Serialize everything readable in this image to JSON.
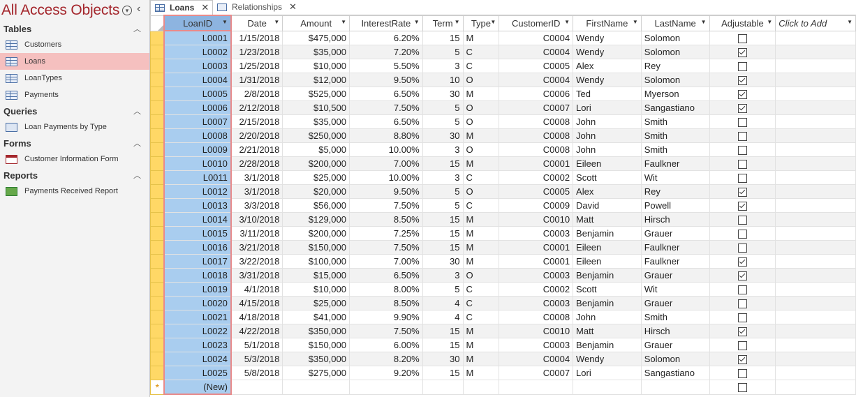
{
  "nav": {
    "title": "All Access Objects",
    "groups": [
      {
        "label": "Tables",
        "items": [
          "Customers",
          "Loans",
          "LoanTypes",
          "Payments"
        ]
      },
      {
        "label": "Queries",
        "items": [
          "Loan Payments by Type"
        ]
      },
      {
        "label": "Forms",
        "items": [
          "Customer Information Form"
        ]
      },
      {
        "label": "Reports",
        "items": [
          "Payments Received Report"
        ]
      }
    ],
    "selected_item": "Loans"
  },
  "tabs": [
    {
      "label": "Loans",
      "active": true
    },
    {
      "label": "Relationships",
      "active": false
    }
  ],
  "columns": [
    "LoanID",
    "Date",
    "Amount",
    "InterestRate",
    "Term",
    "Type",
    "CustomerID",
    "FirstName",
    "LastName",
    "Adjustable",
    "Click to Add"
  ],
  "rows": [
    [
      "L0001",
      "1/15/2018",
      "$475,000",
      "6.20%",
      "15",
      "M",
      "C0004",
      "Wendy",
      "Solomon",
      false
    ],
    [
      "L0002",
      "1/23/2018",
      "$35,000",
      "7.20%",
      "5",
      "C",
      "C0004",
      "Wendy",
      "Solomon",
      true
    ],
    [
      "L0003",
      "1/25/2018",
      "$10,000",
      "5.50%",
      "3",
      "C",
      "C0005",
      "Alex",
      "Rey",
      false
    ],
    [
      "L0004",
      "1/31/2018",
      "$12,000",
      "9.50%",
      "10",
      "O",
      "C0004",
      "Wendy",
      "Solomon",
      true
    ],
    [
      "L0005",
      "2/8/2018",
      "$525,000",
      "6.50%",
      "30",
      "M",
      "C0006",
      "Ted",
      "Myerson",
      true
    ],
    [
      "L0006",
      "2/12/2018",
      "$10,500",
      "7.50%",
      "5",
      "O",
      "C0007",
      "Lori",
      "Sangastiano",
      true
    ],
    [
      "L0007",
      "2/15/2018",
      "$35,000",
      "6.50%",
      "5",
      "O",
      "C0008",
      "John",
      "Smith",
      false
    ],
    [
      "L0008",
      "2/20/2018",
      "$250,000",
      "8.80%",
      "30",
      "M",
      "C0008",
      "John",
      "Smith",
      false
    ],
    [
      "L0009",
      "2/21/2018",
      "$5,000",
      "10.00%",
      "3",
      "O",
      "C0008",
      "John",
      "Smith",
      false
    ],
    [
      "L0010",
      "2/28/2018",
      "$200,000",
      "7.00%",
      "15",
      "M",
      "C0001",
      "Eileen",
      "Faulkner",
      false
    ],
    [
      "L0011",
      "3/1/2018",
      "$25,000",
      "10.00%",
      "3",
      "C",
      "C0002",
      "Scott",
      "Wit",
      false
    ],
    [
      "L0012",
      "3/1/2018",
      "$20,000",
      "9.50%",
      "5",
      "O",
      "C0005",
      "Alex",
      "Rey",
      true
    ],
    [
      "L0013",
      "3/3/2018",
      "$56,000",
      "7.50%",
      "5",
      "C",
      "C0009",
      "David",
      "Powell",
      true
    ],
    [
      "L0014",
      "3/10/2018",
      "$129,000",
      "8.50%",
      "15",
      "M",
      "C0010",
      "Matt",
      "Hirsch",
      false
    ],
    [
      "L0015",
      "3/11/2018",
      "$200,000",
      "7.25%",
      "15",
      "M",
      "C0003",
      "Benjamin",
      "Grauer",
      false
    ],
    [
      "L0016",
      "3/21/2018",
      "$150,000",
      "7.50%",
      "15",
      "M",
      "C0001",
      "Eileen",
      "Faulkner",
      false
    ],
    [
      "L0017",
      "3/22/2018",
      "$100,000",
      "7.00%",
      "30",
      "M",
      "C0001",
      "Eileen",
      "Faulkner",
      true
    ],
    [
      "L0018",
      "3/31/2018",
      "$15,000",
      "6.50%",
      "3",
      "O",
      "C0003",
      "Benjamin",
      "Grauer",
      true
    ],
    [
      "L0019",
      "4/1/2018",
      "$10,000",
      "8.00%",
      "5",
      "C",
      "C0002",
      "Scott",
      "Wit",
      false
    ],
    [
      "L0020",
      "4/15/2018",
      "$25,000",
      "8.50%",
      "4",
      "C",
      "C0003",
      "Benjamin",
      "Grauer",
      false
    ],
    [
      "L0021",
      "4/18/2018",
      "$41,000",
      "9.90%",
      "4",
      "C",
      "C0008",
      "John",
      "Smith",
      false
    ],
    [
      "L0022",
      "4/22/2018",
      "$350,000",
      "7.50%",
      "15",
      "M",
      "C0010",
      "Matt",
      "Hirsch",
      true
    ],
    [
      "L0023",
      "5/1/2018",
      "$150,000",
      "6.00%",
      "15",
      "M",
      "C0003",
      "Benjamin",
      "Grauer",
      false
    ],
    [
      "L0024",
      "5/3/2018",
      "$350,000",
      "8.20%",
      "30",
      "M",
      "C0004",
      "Wendy",
      "Solomon",
      true
    ],
    [
      "L0025",
      "5/8/2018",
      "$275,000",
      "9.20%",
      "15",
      "M",
      "C0007",
      "Lori",
      "Sangastiano",
      false
    ]
  ],
  "new_row": {
    "marker": "*",
    "label": "(New)"
  },
  "colors": {
    "accent": "#a4262c",
    "selected_column": "#a9cdef",
    "row_selector": "#ffd866"
  }
}
